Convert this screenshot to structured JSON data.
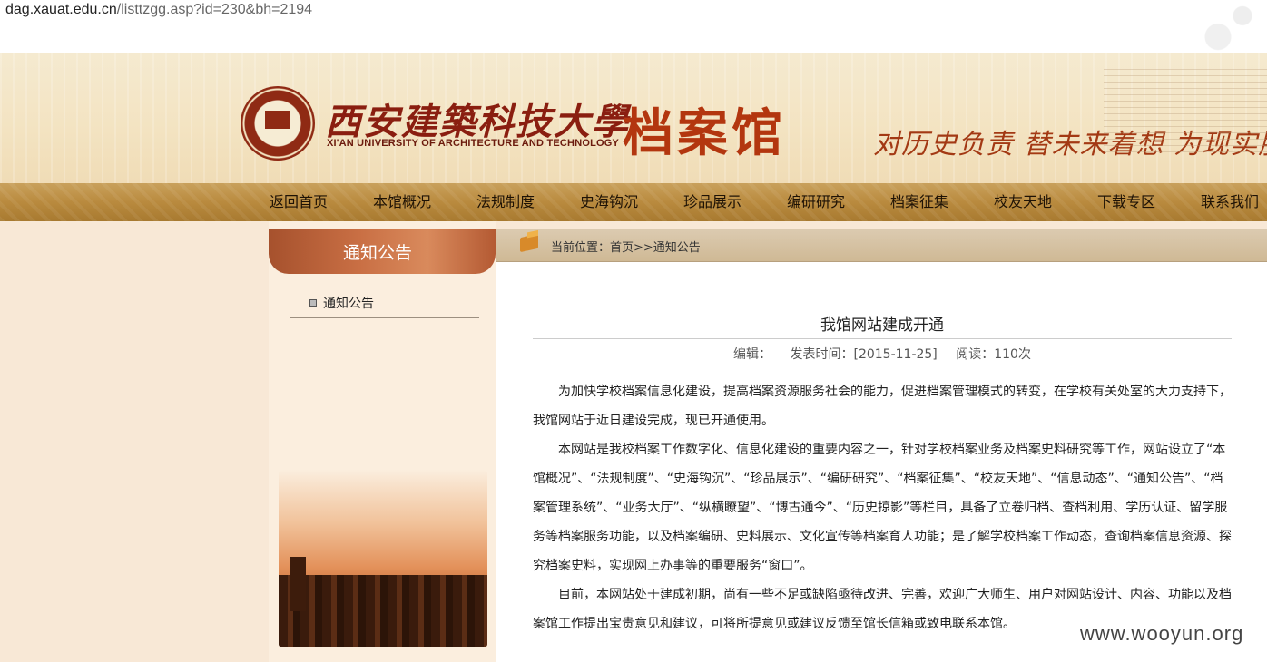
{
  "browser": {
    "url_domain": "dag.xauat.edu.cn",
    "url_path": "/listtzgg.asp?id=230&bh=2194"
  },
  "header": {
    "cn_name": "西安建築科技大學",
    "en_name": "XI'AN UNIVERSITY OF ARCHITECTURE AND TECHNOLOGY",
    "archive_title": "档案馆",
    "slogan": "对历史负责  替未来着想  为现实服"
  },
  "nav": {
    "items": [
      "返回首页",
      "本馆概况",
      "法规制度",
      "史海钩沉",
      "珍品展示",
      "编研研究",
      "档案征集",
      "校友天地",
      "下载专区",
      "联系我们"
    ]
  },
  "sidebar": {
    "heading": "通知公告",
    "items": [
      {
        "label": "通知公告"
      }
    ]
  },
  "breadcrumb": {
    "text": "当前位置：首页>>通知公告"
  },
  "article": {
    "title": "我馆网站建成开通",
    "editor": "编辑：",
    "publish_time": "发表时间：[2015-11-25]",
    "reads": "阅读：110次",
    "paragraphs": [
      "为加快学校档案信息化建设，提高档案资源服务社会的能力，促进档案管理模式的转变，在学校有关处室的大力支持下，我馆网站于近日建设完成，现已开通使用。",
      "本网站是我校档案工作数字化、信息化建设的重要内容之一，针对学校档案业务及档案史料研究等工作，网站设立了“本馆概况”、“法规制度”、“史海钩沉”、“珍品展示”、“编研研究”、“档案征集”、“校友天地”、“信息动态”、“通知公告”、“档案管理系统”、“业务大厅”、“纵横瞭望”、“博古通今”、“历史掠影”等栏目，具备了立卷归档、查档利用、学历认证、留学服务等档案服务功能，以及档案编研、史料展示、文化宣传等档案育人功能；是了解学校档案工作动态，查询档案信息资源、探究档案史料，实现网上办事等的重要服务“窗口”。",
      "目前，本网站处于建成初期，尚有一些不足或缺陷亟待改进、完善，欢迎广大师生、用户对网站设计、内容、功能以及档案馆工作提出宝贵意见和建议，可将所提意见或建议反馈至馆长信箱或致电联系本馆。"
    ]
  },
  "watermark": "www.wooyun.org"
}
